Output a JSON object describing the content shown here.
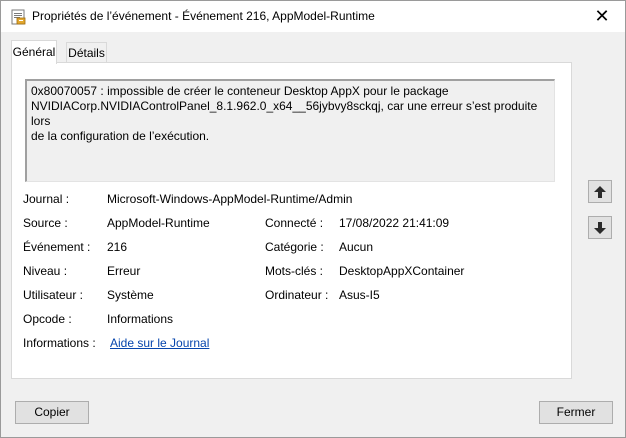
{
  "window": {
    "title": "Propriétés de l’événement - Événement 216, AppModel-Runtime",
    "app_icon": "event-viewer-icon",
    "close_glyph": "✕"
  },
  "tabs": [
    {
      "label": "Général",
      "active": true
    },
    {
      "label": "Détails",
      "active": false
    }
  ],
  "event": {
    "description_lines": [
      "0x80070057 : impossible de créer le conteneur Desktop AppX pour le package",
      "NVIDIACorp.NVIDIAControlPanel_8.1.962.0_x64__56jybvy8sckqj, car une erreur s’est produite lors",
      "de la configuration de l’exécution."
    ],
    "journal_label": "Journal :",
    "journal_value": "Microsoft-Windows-AppModel-Runtime/Admin",
    "source_label": "Source :",
    "source_value": "AppModel-Runtime",
    "connected_label": "Connecté :",
    "connected_value": "17/08/2022 21:41:09",
    "event_label": "Événement :",
    "event_value": "216",
    "category_label": "Catégorie :",
    "category_value": "Aucun",
    "level_label": "Niveau :",
    "level_value": "Erreur",
    "keywords_label": "Mots-clés :",
    "keywords_value": "DesktopAppXContainer",
    "user_label": "Utilisateur :",
    "user_value": "Système",
    "computer_label": "Ordinateur :",
    "computer_value": "Asus-I5",
    "opcode_label": "Opcode :",
    "opcode_value": "Informations",
    "info_label": "Informations :",
    "info_link": "Aide sur le Journal"
  },
  "navigation": {
    "up_icon": "arrow-up-icon",
    "down_icon": "arrow-down-icon"
  },
  "footer": {
    "copy_label": "Copier",
    "close_label": "Fermer"
  }
}
